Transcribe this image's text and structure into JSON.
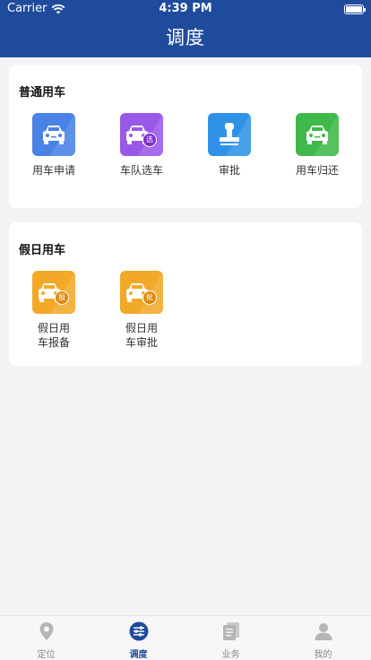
{
  "status_bar": {
    "carrier": "Carrier",
    "time": "4:39 PM"
  },
  "header": {
    "title": "调度"
  },
  "sections": [
    {
      "title": "普通用车",
      "items": [
        {
          "label": "用车申请",
          "icon": "car-icon",
          "color": "#4a82e6"
        },
        {
          "label": "车队选车",
          "icon": "car-select-icon",
          "color": "#9a58e6",
          "badge": "选"
        },
        {
          "label": "审批",
          "icon": "stamp-icon",
          "color": "#2f92e8"
        },
        {
          "label": "用车归还",
          "icon": "car-return-icon",
          "color": "#3fb94a"
        }
      ]
    },
    {
      "title": "假日用车",
      "items": [
        {
          "label_line1": "假日用",
          "label_line2": "车报备",
          "icon": "car-report-icon",
          "color": "#f2a928",
          "badge": "报"
        },
        {
          "label_line1": "假日用",
          "label_line2": "车审批",
          "icon": "car-approve-icon",
          "color": "#f2a928",
          "badge": "批"
        }
      ]
    }
  ],
  "tabbar": {
    "tabs": [
      {
        "label": "定位",
        "icon": "location-pin-icon",
        "active": false
      },
      {
        "label": "调度",
        "icon": "dispatch-sliders-icon",
        "active": true
      },
      {
        "label": "业务",
        "icon": "business-documents-icon",
        "active": false
      },
      {
        "label": "我的",
        "icon": "profile-icon",
        "active": false
      }
    ]
  },
  "colors": {
    "header": "#1f4b9c",
    "background": "#f3f3f5",
    "active_tab": "#1f4b9c",
    "inactive_tab": "#b5b5b5"
  }
}
